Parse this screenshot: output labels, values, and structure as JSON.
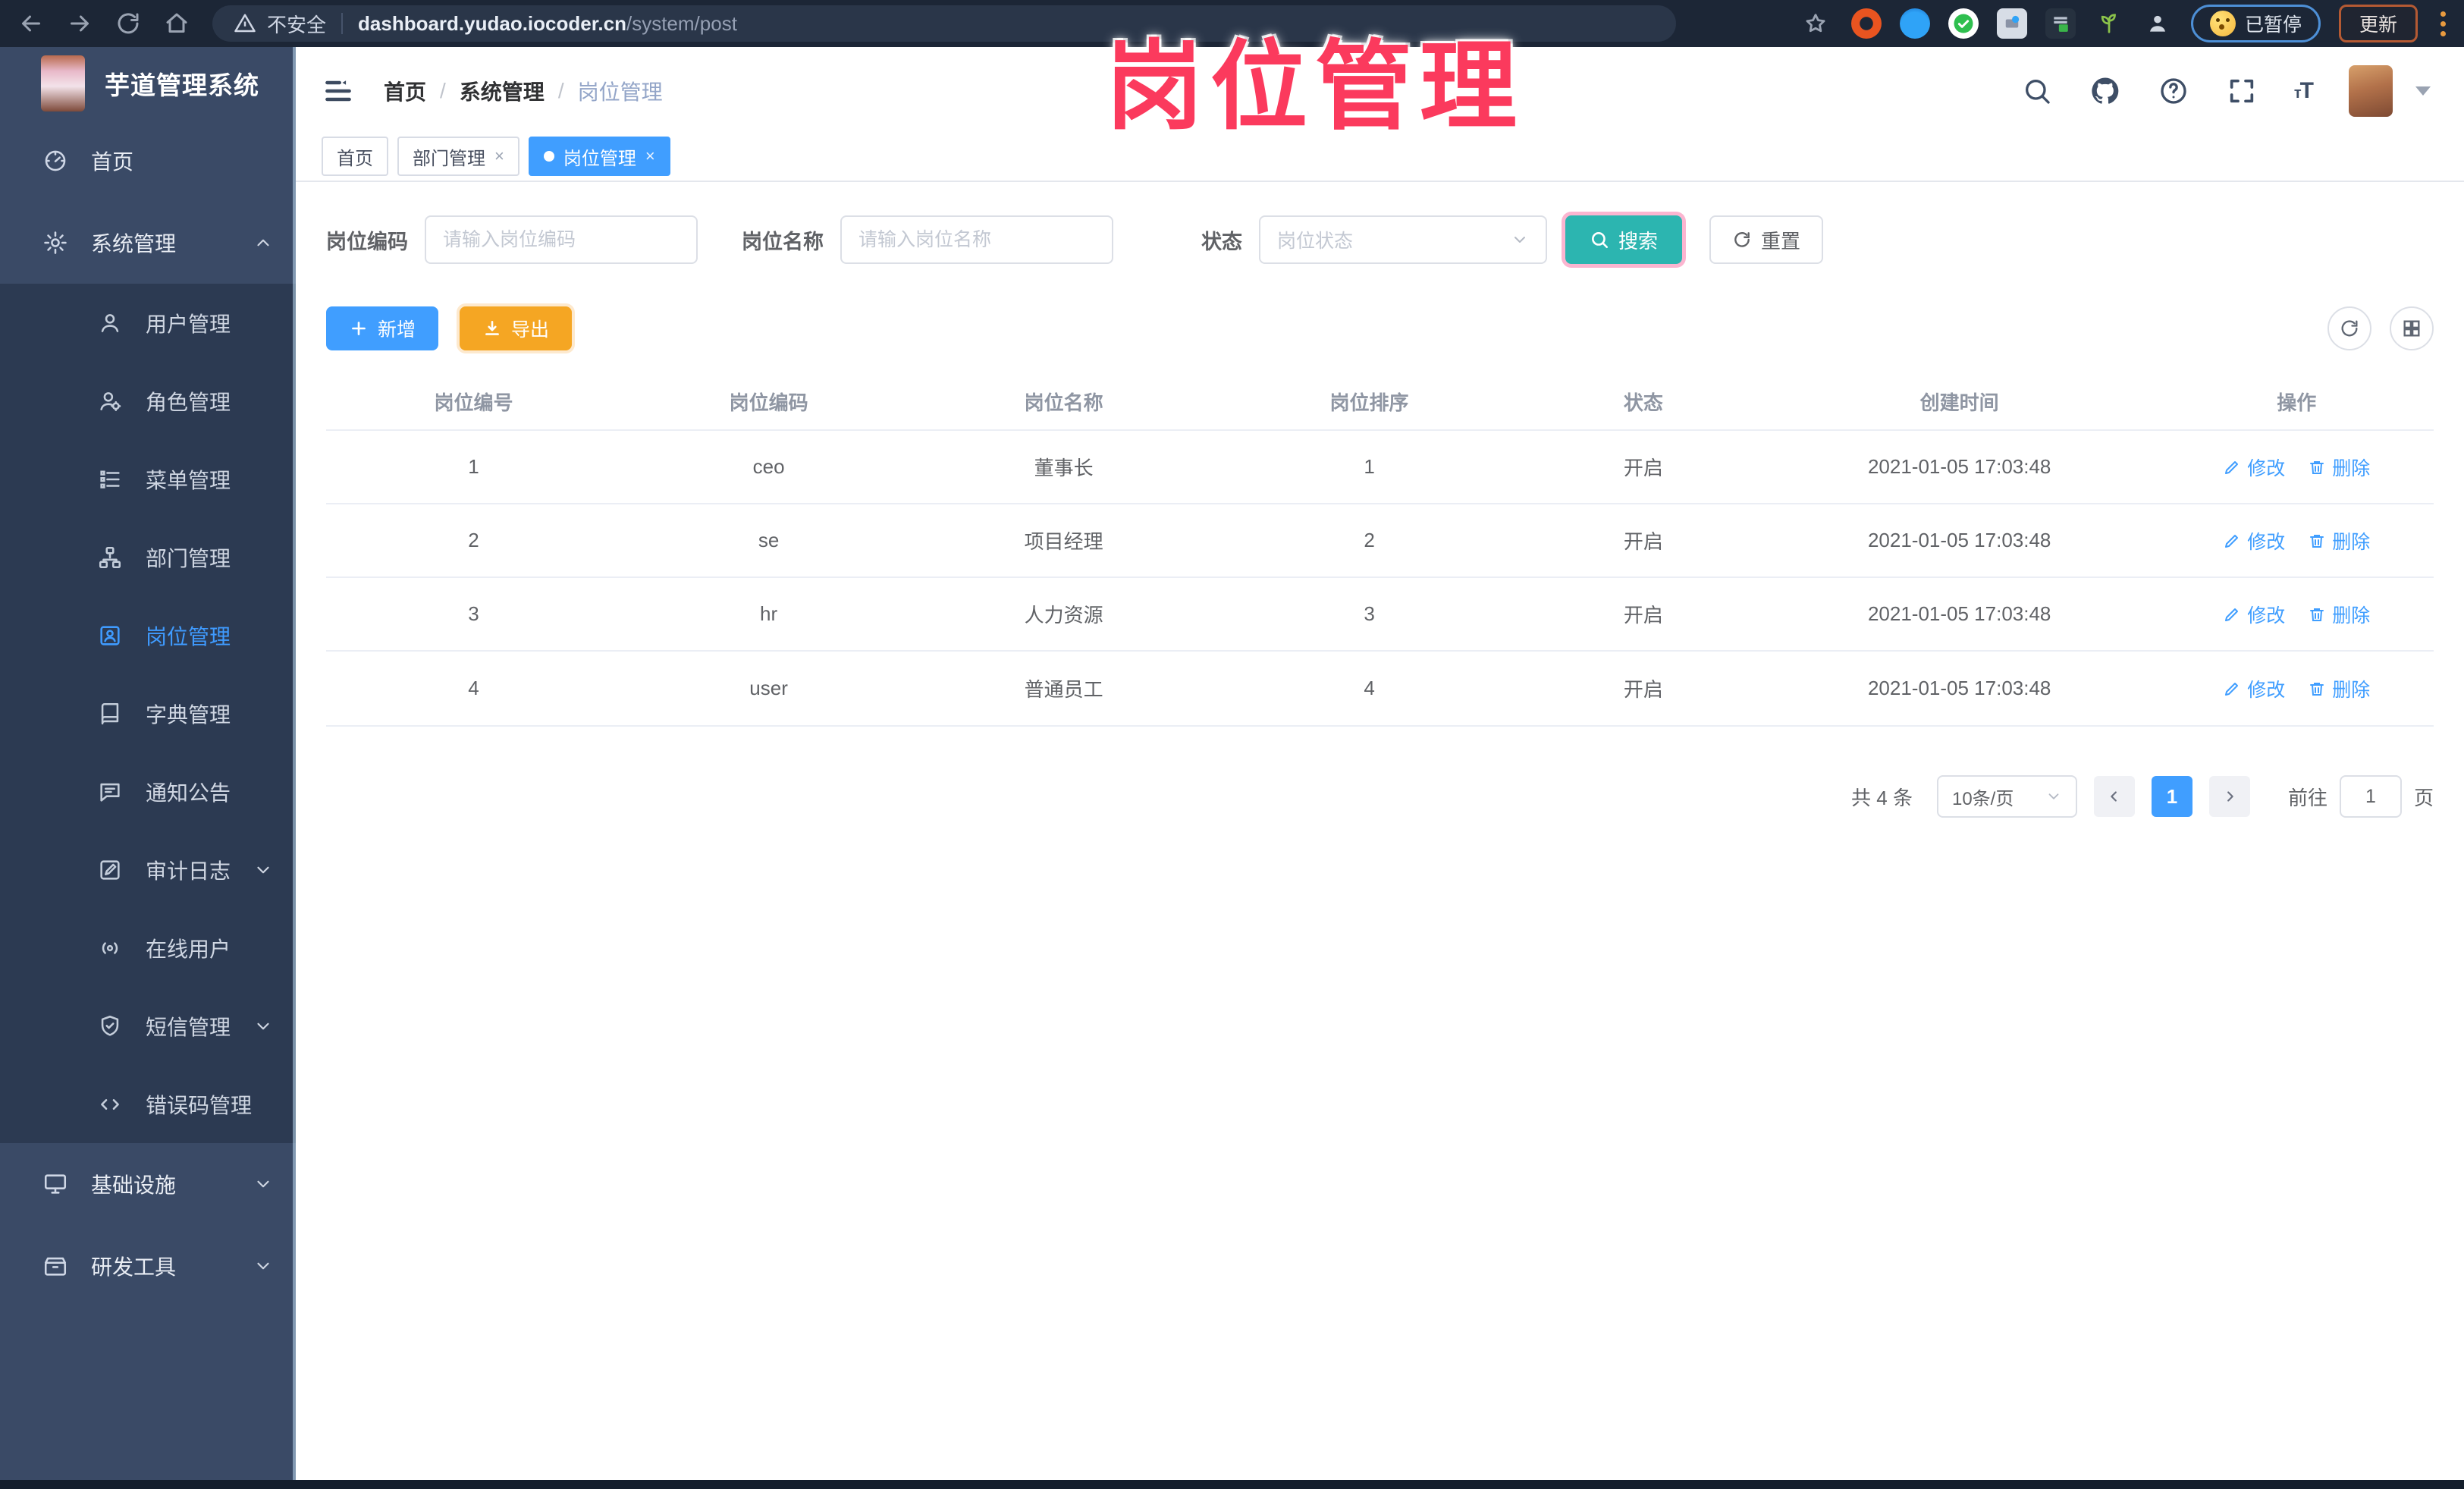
{
  "chrome": {
    "secure_label": "不安全",
    "url_host": "dashboard.yudao.iocoder.cn",
    "url_path": "/system/post",
    "paused_label": "已暂停",
    "update_label": "更新"
  },
  "overlay": {
    "text": "岗位管理"
  },
  "sidebar": {
    "app_title": "芋道管理系统",
    "items": [
      {
        "label": "首页",
        "level": "root"
      },
      {
        "label": "系统管理",
        "level": "root",
        "expanded": true
      },
      {
        "label": "用户管理",
        "level": "sub"
      },
      {
        "label": "角色管理",
        "level": "sub"
      },
      {
        "label": "菜单管理",
        "level": "sub"
      },
      {
        "label": "部门管理",
        "level": "sub"
      },
      {
        "label": "岗位管理",
        "level": "sub",
        "active": true
      },
      {
        "label": "字典管理",
        "level": "sub"
      },
      {
        "label": "通知公告",
        "level": "sub"
      },
      {
        "label": "审计日志",
        "level": "sub",
        "collapsible": true
      },
      {
        "label": "在线用户",
        "level": "sub"
      },
      {
        "label": "短信管理",
        "level": "sub",
        "collapsible": true
      },
      {
        "label": "错误码管理",
        "level": "sub"
      },
      {
        "label": "基础设施",
        "level": "root",
        "collapsible": true
      },
      {
        "label": "研发工具",
        "level": "root",
        "collapsible": true
      }
    ]
  },
  "breadcrumb": {
    "items": [
      "首页",
      "系统管理",
      "岗位管理"
    ]
  },
  "tabs": {
    "items": [
      {
        "label": "首页"
      },
      {
        "label": "部门管理"
      },
      {
        "label": "岗位管理"
      }
    ]
  },
  "filters": {
    "post_code_label": "岗位编码",
    "post_code_placeholder": "请输入岗位编码",
    "post_name_label": "岗位名称",
    "post_name_placeholder": "请输入岗位名称",
    "status_label": "状态",
    "status_placeholder": "岗位状态",
    "search_label": "搜索",
    "reset_label": "重置"
  },
  "toolbar": {
    "add_label": "新增",
    "export_label": "导出"
  },
  "table": {
    "columns": [
      "岗位编号",
      "岗位编码",
      "岗位名称",
      "岗位排序",
      "状态",
      "创建时间",
      "操作"
    ],
    "edit_label": "修改",
    "delete_label": "删除",
    "rows": [
      {
        "id": "1",
        "code": "ceo",
        "name": "董事长",
        "sort": "1",
        "status": "开启",
        "created": "2021-01-05 17:03:48"
      },
      {
        "id": "2",
        "code": "se",
        "name": "项目经理",
        "sort": "2",
        "status": "开启",
        "created": "2021-01-05 17:03:48"
      },
      {
        "id": "3",
        "code": "hr",
        "name": "人力资源",
        "sort": "3",
        "status": "开启",
        "created": "2021-01-05 17:03:48"
      },
      {
        "id": "4",
        "code": "user",
        "name": "普通员工",
        "sort": "4",
        "status": "开启",
        "created": "2021-01-05 17:03:48"
      }
    ]
  },
  "pagination": {
    "total_label": "共 4 条",
    "page_size_label": "10条/页",
    "current_page": "1",
    "goto_label": "前往",
    "goto_value": "1",
    "page_label": "页"
  },
  "colors": {
    "accent_blue": "#409eff",
    "search_teal": "#2cb5b0",
    "export_orange": "#f5a623",
    "overlay_pink": "#fb3a5d",
    "sidebar_bg": "#3a4a66",
    "submenu_bg": "#2c3a52"
  },
  "icons": {
    "browser": [
      "back-icon",
      "forward-icon",
      "reload-icon",
      "home-icon",
      "warning-icon",
      "star-icon",
      "extension-icons",
      "kebab-menu-icon"
    ],
    "navbar": [
      "hamburger-icon",
      "search-icon",
      "github-icon",
      "help-icon",
      "fullscreen-icon",
      "font-size-icon",
      "caret-down-icon"
    ],
    "table_actions": [
      "edit-pencil-icon",
      "delete-trash-icon"
    ]
  }
}
